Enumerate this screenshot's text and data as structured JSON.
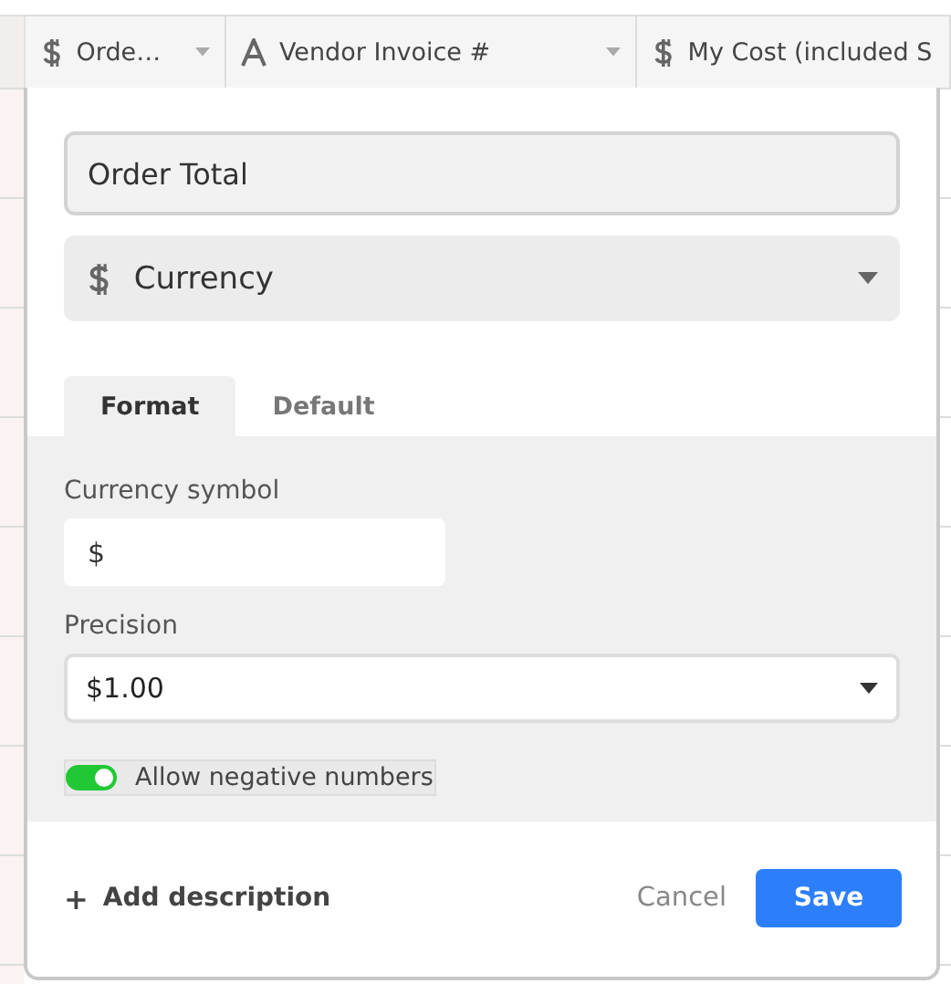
{
  "grid_header": {
    "columns": [
      {
        "label": "Orde…",
        "kind": "currency"
      },
      {
        "label": "Vendor Invoice #",
        "kind": "text"
      },
      {
        "label": "My Cost (included S",
        "kind": "currency"
      }
    ]
  },
  "field_dialog": {
    "name_field": {
      "value": "Order Total"
    },
    "type_select": {
      "value": "Currency"
    },
    "tabs": [
      {
        "label": "Format",
        "selected": true
      },
      {
        "label": "Default",
        "selected": false
      }
    ],
    "currency_symbol": {
      "label": "Currency symbol",
      "value": "$"
    },
    "precision": {
      "label": "Precision",
      "value": "$1.00"
    },
    "allow_negative": {
      "label": "Allow negative numbers",
      "on": true
    },
    "add_description": {
      "icon": "+",
      "label": "Add description"
    },
    "buttons": {
      "cancel": "Cancel",
      "save": "Save"
    }
  }
}
